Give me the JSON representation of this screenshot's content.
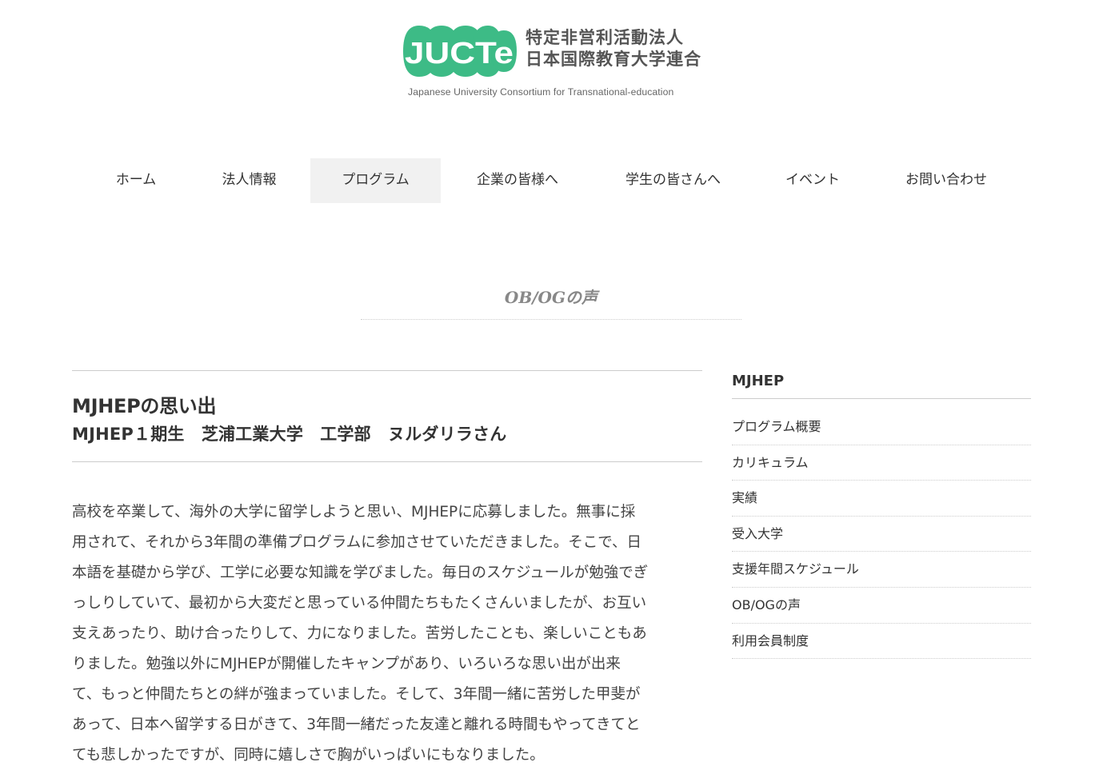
{
  "logo": {
    "mark_text": "JUCTe",
    "name_line1": "特定非営利活動法人",
    "name_line2": "日本国際教育大学連合",
    "english_name": "Japanese University Consortium for Transnational-education",
    "color": "#3dbb86"
  },
  "nav": {
    "items": [
      {
        "label": "ホーム"
      },
      {
        "label": "法人情報"
      },
      {
        "label": "プログラム"
      },
      {
        "label": "企業の皆様へ"
      },
      {
        "label": "学生の皆さんへ"
      },
      {
        "label": "イベント"
      },
      {
        "label": "お問い合わせ"
      }
    ],
    "active": "プログラム"
  },
  "page": {
    "title": "OB/OGの声"
  },
  "article": {
    "title": "MJHEPの思い出",
    "subtitle": "MJHEP１期生　芝浦工業大学　工学部　ヌルダリラさん",
    "body_lines": [
      "高校を卒業して、海外の大学に留学しようと思い、MJHEPに応募しました。無事に採",
      "用されて、それから3年間の準備プログラムに参加させていただきました。そこで、日",
      "本語を基礎から学び、工学に必要な知識を学びました。毎日のスケジュールが勉強でぎ",
      "っしりしていて、最初から大変だと思っている仲間たちもたくさんいましたが、お互い",
      "支えあったり、助け合ったりして、力になりました。苦労したことも、楽しいこともあ",
      "りました。勉強以外にMJHEPが開催したキャンプがあり、いろいろな思い出が出来",
      "て、もっと仲間たちとの絆が強まっていました。そして、3年間一緒に苦労した甲斐が",
      "あって、日本へ留学する日がきて、3年間一緒だった友達と離れる時間もやってきてと",
      "ても悲しかったですが、同時に嬉しさで胸がいっぱいにもなりました。"
    ]
  },
  "sidebar": {
    "heading": "MJHEP",
    "items": [
      {
        "label": "プログラム概要"
      },
      {
        "label": "カリキュラム"
      },
      {
        "label": "実績"
      },
      {
        "label": "受入大学"
      },
      {
        "label": "支援年間スケジュール"
      },
      {
        "label": "OB/OGの声"
      },
      {
        "label": "利用会員制度"
      }
    ]
  }
}
